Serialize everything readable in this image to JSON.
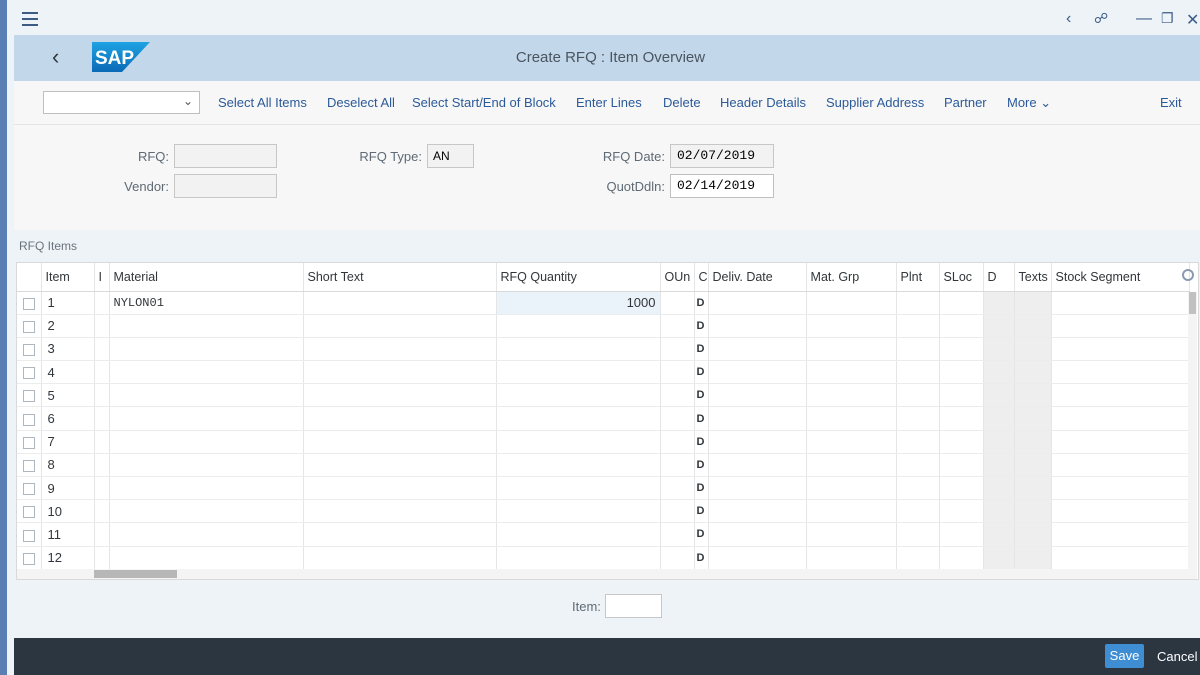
{
  "window": {
    "controls": [
      "chevron-left-icon",
      "unlock-icon",
      "minimize-icon",
      "restore-icon",
      "close-icon"
    ]
  },
  "header": {
    "logo": "SAP",
    "title": "Create RFQ : Item Overview"
  },
  "toolbar": {
    "select_value": "",
    "buttons": [
      "Select All Items",
      "Deselect All",
      "Select Start/End of Block",
      "Enter Lines",
      "Delete",
      "Header Details",
      "Supplier Address",
      "Partner",
      "More"
    ],
    "exit": "Exit"
  },
  "form": {
    "rfq_label": "RFQ:",
    "rfq_value": "",
    "vendor_label": "Vendor:",
    "vendor_value": "",
    "rfq_type_label": "RFQ Type:",
    "rfq_type_value": "AN",
    "rfq_date_label": "RFQ Date:",
    "rfq_date_value": "02/07/2019",
    "quot_label": "QuotDdln:",
    "quot_value": "02/14/2019"
  },
  "section": {
    "title": "RFQ Items"
  },
  "table": {
    "columns": [
      "",
      "Item",
      "I",
      "Material",
      "Short Text",
      "RFQ Quantity",
      "OUn",
      "C",
      "Deliv. Date",
      "Mat. Grp",
      "Plnt",
      "SLoc",
      "D",
      "Texts",
      "Stock Segment"
    ],
    "rows": [
      {
        "item": "1",
        "material": "NYLON01",
        "qty": "1000",
        "c": "D"
      },
      {
        "item": "2",
        "material": "",
        "qty": "",
        "c": "D"
      },
      {
        "item": "3",
        "material": "",
        "qty": "",
        "c": "D"
      },
      {
        "item": "4",
        "material": "",
        "qty": "",
        "c": "D"
      },
      {
        "item": "5",
        "material": "",
        "qty": "",
        "c": "D"
      },
      {
        "item": "6",
        "material": "",
        "qty": "",
        "c": "D"
      },
      {
        "item": "7",
        "material": "",
        "qty": "",
        "c": "D"
      },
      {
        "item": "8",
        "material": "",
        "qty": "",
        "c": "D"
      },
      {
        "item": "9",
        "material": "",
        "qty": "",
        "c": "D"
      },
      {
        "item": "10",
        "material": "",
        "qty": "",
        "c": "D"
      },
      {
        "item": "11",
        "material": "",
        "qty": "",
        "c": "D"
      },
      {
        "item": "12",
        "material": "",
        "qty": "",
        "c": "D"
      }
    ]
  },
  "item_nav": {
    "label": "Item:",
    "value": ""
  },
  "footer": {
    "save": "Save",
    "cancel": "Cancel"
  }
}
